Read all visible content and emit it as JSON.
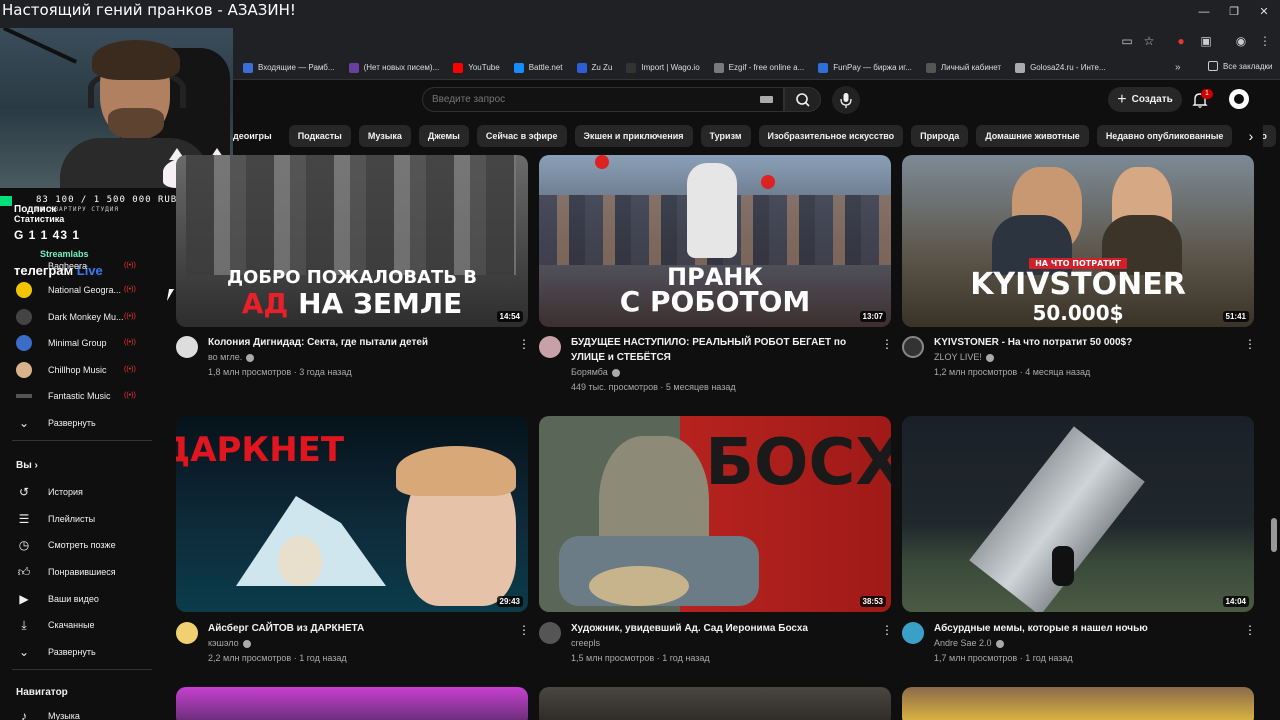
{
  "stream": {
    "title": "Настоящий гений пранков - АЗАЗИН!",
    "goal_text": "83 100 / 1 500 000 RUB",
    "goal_sub": "НА КВАРТИРУ СТУДИЯ",
    "podpis": "Подписк",
    "stat": "Статистика",
    "counts": "G 1  1  43  1",
    "streamlabs": "Streamlabs",
    "telegram": "телеграм",
    "telegram_link": "Live"
  },
  "bookmarks": [
    {
      "label": "Входящие — Рамб...",
      "color": "#3b6fd8"
    },
    {
      "label": "(Нет новых писем)...",
      "color": "#6b3fa0"
    },
    {
      "label": "YouTube",
      "color": "#ff0000"
    },
    {
      "label": "Battle.net",
      "color": "#148eff"
    },
    {
      "label": "Zu Zu",
      "color": "#2c5fd6"
    },
    {
      "label": "Import | Wago.io",
      "color": "#333333"
    },
    {
      "label": "Ezgif - free online a...",
      "color": "#7a7a7a"
    },
    {
      "label": "FunPay — биржа иг...",
      "color": "#2f6fdc"
    },
    {
      "label": "Личный кабинет",
      "color": "#555555"
    },
    {
      "label": "Golosa24.ru - Инте...",
      "color": "#aaaaaa"
    }
  ],
  "bookmarks_all": "Все закладки",
  "search": {
    "placeholder": "Введите запрос"
  },
  "header": {
    "create_label": "Создать",
    "notif_count": "1"
  },
  "chips": [
    "деоигры",
    "Подкасты",
    "Музыка",
    "Джемы",
    "Сейчас в эфире",
    "Экшен и приключения",
    "Туризм",
    "Изобразительное искусство",
    "Природа",
    "Домашние животные",
    "Недавно опубликованные",
    "Про"
  ],
  "sidebar": {
    "subs": [
      {
        "label": "Bagheera",
        "color": "#7a5c3a"
      },
      {
        "label": "National Geogra...",
        "color": "#f3c400"
      },
      {
        "label": "Dark Monkey Mu...",
        "color": "#444444"
      },
      {
        "label": "Minimal Group",
        "color": "#3a6cc8"
      },
      {
        "label": "Chillhop Music",
        "color": "#d9b48a"
      },
      {
        "label": "Fantastic Music",
        "color": "#222222"
      }
    ],
    "expand1": "Развернуть",
    "you_label": "Вы",
    "you_items": [
      "История",
      "Плейлисты",
      "Смотреть позже",
      "Понравившиеся",
      "Ваши видео",
      "Скачанные"
    ],
    "expand2": "Развернуть",
    "nav_label": "Навигатор",
    "nav_first": "Музыка"
  },
  "videos": [
    {
      "title": "Колония Дигнидад: Секта, где пытали детей",
      "channel": "во мгле.",
      "meta": "1,8 млн просмотров · 3 года назад",
      "duration": "14:54",
      "thumb_line1": "ДОБРО ПОЖАЛОВАТЬ В",
      "thumb_line2a": "АД",
      "thumb_line2b": "НА ЗЕМЛЕ"
    },
    {
      "title": "БУДУЩЕЕ НАСТУПИЛО: РЕАЛЬНЫЙ РОБОТ БЕГАЕТ по УЛИЦЕ и СТЕБЁТСЯ",
      "channel": "Борямба",
      "meta": "449 тыс. просмотров · 5 месяцев назад",
      "duration": "13:07",
      "thumb_line1": "ПРАНК",
      "thumb_line2": "С РОБОТОМ"
    },
    {
      "title": "KYIVSTONER - На что потратит 50 000$?",
      "channel": "ZLOY LIVE!",
      "meta": "1,2 млн просмотров · 4 месяца назад",
      "duration": "51:41",
      "thumb_tag": "НА ЧТО ПОТРАТИТ",
      "thumb_line1": "KYIVSTONER",
      "thumb_line2": "50.000$"
    },
    {
      "title": "Айсберг САЙТОВ из ДАРКНЕТА",
      "channel": "кэшэло",
      "meta": "2,2 млн просмотров · 1 год назад",
      "duration": "29:43",
      "thumb_line1": "ДАРКНЕТ"
    },
    {
      "title": "Художник, увидевший Ад. Сад Иеронима Босха",
      "channel": "creepls",
      "meta": "1,5 млн просмотров · 1 год назад",
      "duration": "38:53",
      "thumb_line1": "БОСХ"
    },
    {
      "title": "Абсурдные мемы, которые я нашел ночью",
      "channel": "Andre Sae 2.0",
      "meta": "1,7 млн просмотров · 1 год назад",
      "duration": "14:04"
    }
  ],
  "colors": {
    "bg": "#0f0f0f",
    "chip": "#272727",
    "accent_red": "#ff0000",
    "live_red": "#ff3333"
  }
}
